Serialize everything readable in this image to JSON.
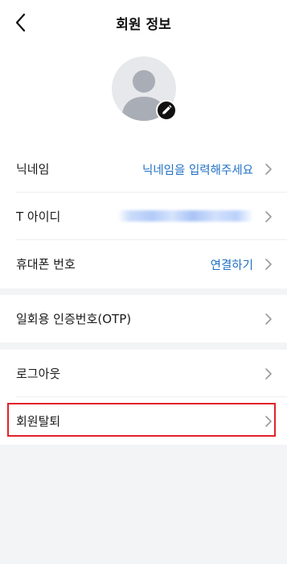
{
  "header": {
    "title": "회원 정보",
    "back_icon": "chevron-left-icon"
  },
  "profile": {
    "avatar_icon": "person-silhouette-icon",
    "edit_icon": "pencil-icon"
  },
  "sections": [
    {
      "rows": [
        {
          "label": "닉네임",
          "value": "닉네임을 입력해주세요"
        },
        {
          "label": "T 아이디",
          "value": ""
        },
        {
          "label": "휴대폰 번호",
          "value": "연결하기"
        }
      ]
    },
    {
      "rows": [
        {
          "label": "일회용 인증번호(OTP)",
          "value": ""
        }
      ]
    },
    {
      "rows": [
        {
          "label": "로그아웃",
          "value": ""
        },
        {
          "label": "회원탈퇴",
          "value": ""
        }
      ]
    }
  ],
  "colors": {
    "accent_text": "#1f70c4",
    "highlight_box": "#e1222b",
    "background": "#f3f4f6"
  }
}
